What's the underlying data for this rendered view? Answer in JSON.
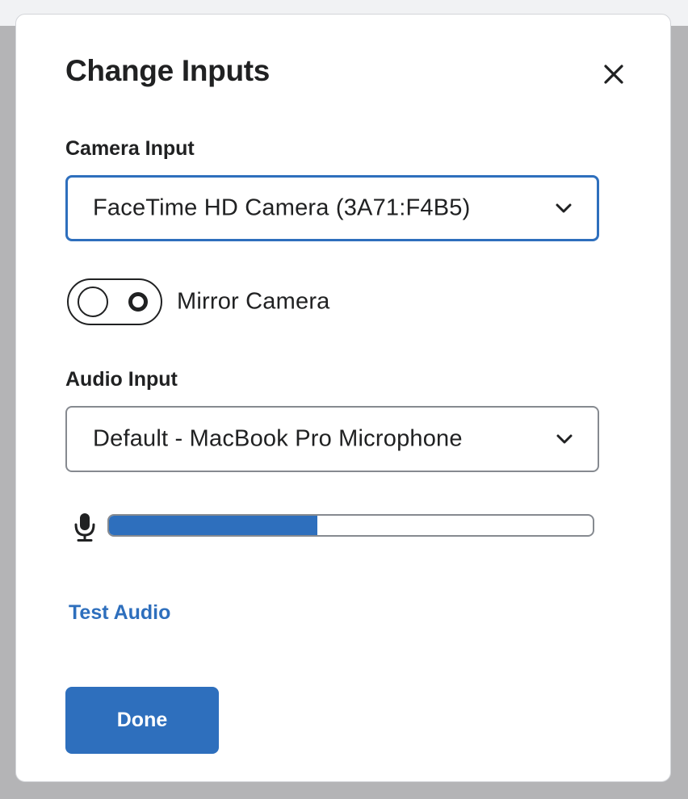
{
  "dialog": {
    "title": "Change Inputs",
    "close_icon": "close-icon"
  },
  "camera": {
    "label": "Camera Input",
    "selected": "FaceTime HD Camera (3A71:F4B5)",
    "mirror_label": "Mirror Camera",
    "mirror_enabled": false
  },
  "audio": {
    "label": "Audio Input",
    "selected": "Default - MacBook Pro Microphone",
    "level_icon": "microphone-icon",
    "level_percent": 43,
    "test_label": "Test Audio"
  },
  "footer": {
    "done_label": "Done"
  },
  "colors": {
    "accent": "#2e6fbd",
    "text": "#202122",
    "border": "#868a90",
    "backdrop": "#b4b4b6"
  }
}
